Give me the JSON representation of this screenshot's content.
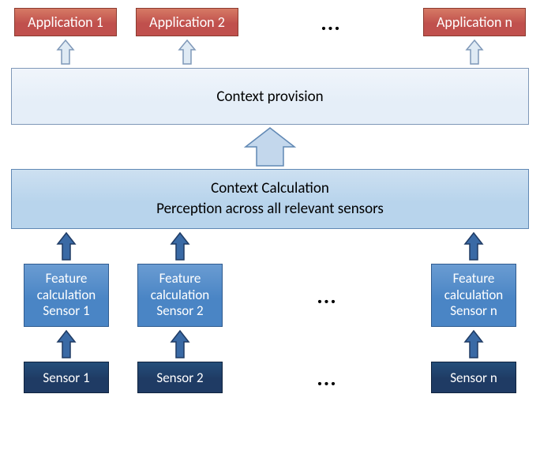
{
  "applications": {
    "items": [
      "Application 1",
      "Application 2",
      "Application n"
    ],
    "ellipsis": "..."
  },
  "context_provision": {
    "label": "Context provision"
  },
  "context_calculation": {
    "line1": "Context Calculation",
    "line2": "Perception across all relevant sensors"
  },
  "features": {
    "items": [
      {
        "l1": "Feature",
        "l2": "calculation",
        "l3": "Sensor 1"
      },
      {
        "l1": "Feature",
        "l2": "calculation",
        "l3": "Sensor 2"
      },
      {
        "l1": "Feature",
        "l2": "calculation",
        "l3": "Sensor n"
      }
    ],
    "ellipsis": "..."
  },
  "sensors": {
    "items": [
      "Sensor 1",
      "Sensor 2",
      "Sensor n"
    ],
    "ellipsis": "..."
  }
}
